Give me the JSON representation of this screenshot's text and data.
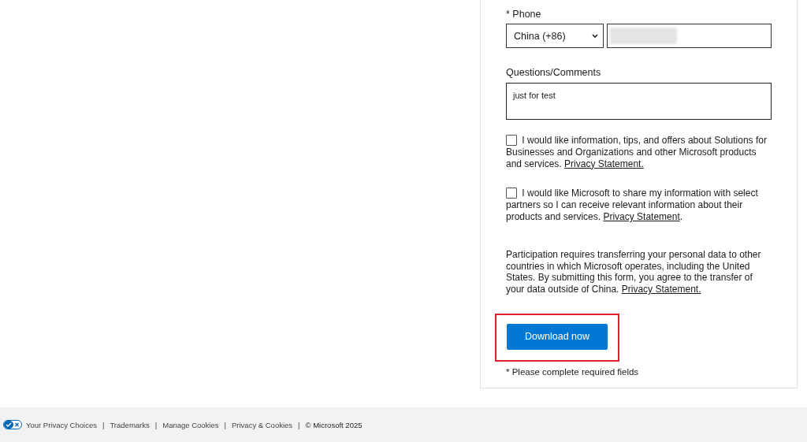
{
  "phone": {
    "label": "* Phone",
    "country": "China (+86)"
  },
  "comments": {
    "label": "Questions/Comments",
    "value": "just for test"
  },
  "consents": [
    {
      "checked": false,
      "text": "I would like information, tips, and offers about Solutions for Businesses and Organizations and other Microsoft products and services.",
      "link": "Privacy Statement."
    },
    {
      "checked": false,
      "text": "I would like Microsoft to share my information with select partners so I can receive relevant information about their products and services.",
      "link": "Privacy Statement",
      "after": "."
    }
  ],
  "notice": {
    "text": "Participation requires transferring your personal data to other countries in which Microsoft operates, including the United States. By submitting this form, you agree to the transfer of your data outside of China.",
    "link": "Privacy Statement."
  },
  "submit": {
    "label": "Download now",
    "highlighted": true
  },
  "required_note": "* Please complete required fields",
  "footer": [
    {
      "kind": "link",
      "text": "Your Privacy Choices",
      "icon": true
    },
    {
      "kind": "separator",
      "text": "|"
    },
    {
      "kind": "link",
      "text": "Trademarks"
    },
    {
      "kind": "separator",
      "text": "|"
    },
    {
      "kind": "link",
      "text": "Manage Cookies"
    },
    {
      "kind": "separator",
      "text": "|"
    },
    {
      "kind": "link",
      "text": "Privacy & Cookies"
    },
    {
      "kind": "separator",
      "text": "|"
    },
    {
      "kind": "copyright",
      "text": "© Microsoft 2025"
    }
  ]
}
